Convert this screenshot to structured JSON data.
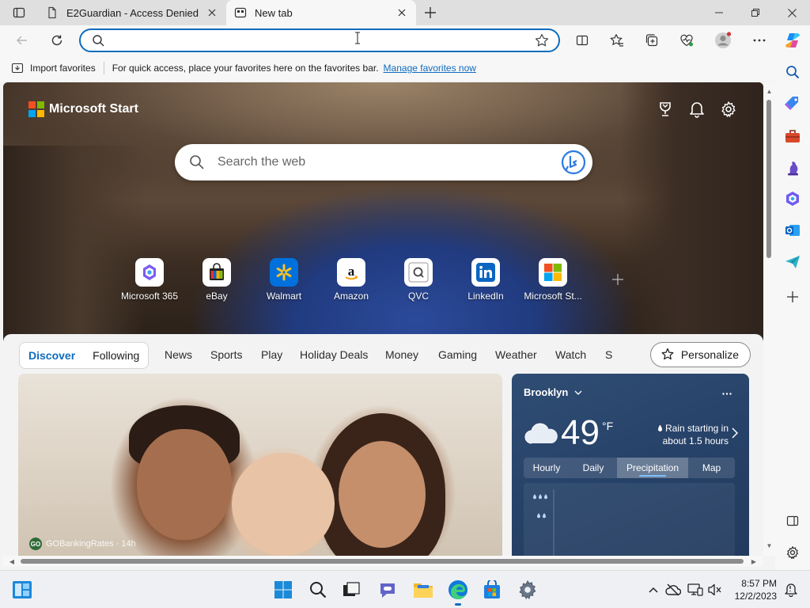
{
  "tabs": [
    {
      "title": "E2Guardian - Access Denied",
      "active": false
    },
    {
      "title": "New tab",
      "active": true
    }
  ],
  "addressbar": {
    "value": "",
    "placeholder": ""
  },
  "favorites_bar": {
    "import_label": "Import favorites",
    "message": "For quick access, place your favorites here on the favorites bar.",
    "link": "Manage favorites now"
  },
  "hero": {
    "brand": "Microsoft Start",
    "search_placeholder": "Search the web"
  },
  "quicklinks": [
    {
      "label": "Microsoft 365"
    },
    {
      "label": "eBay"
    },
    {
      "label": "Walmart"
    },
    {
      "label": "Amazon"
    },
    {
      "label": "QVC"
    },
    {
      "label": "LinkedIn"
    },
    {
      "label": "Microsoft St..."
    }
  ],
  "feed_nav": {
    "segments": [
      "Discover",
      "Following"
    ],
    "categories": [
      "News",
      "Sports",
      "Play",
      "Holiday Deals",
      "Money",
      "Gaming",
      "Weather",
      "Watch",
      "S"
    ],
    "personalize": "Personalize"
  },
  "main_card": {
    "source": "GOBankingRates · 14h",
    "source_badge": "GO"
  },
  "weather": {
    "city": "Brooklyn",
    "temp": "49",
    "unit": "°F",
    "forecast": "Rain starting in about 1.5 hours",
    "tabs": [
      "Hourly",
      "Daily",
      "Precipitation",
      "Map"
    ],
    "active_tab": "Precipitation"
  },
  "clock": {
    "time": "8:57 PM",
    "date": "12/2/2023"
  },
  "colors": {
    "accent": "#0f6cbd",
    "weather_bg": "#274268"
  }
}
